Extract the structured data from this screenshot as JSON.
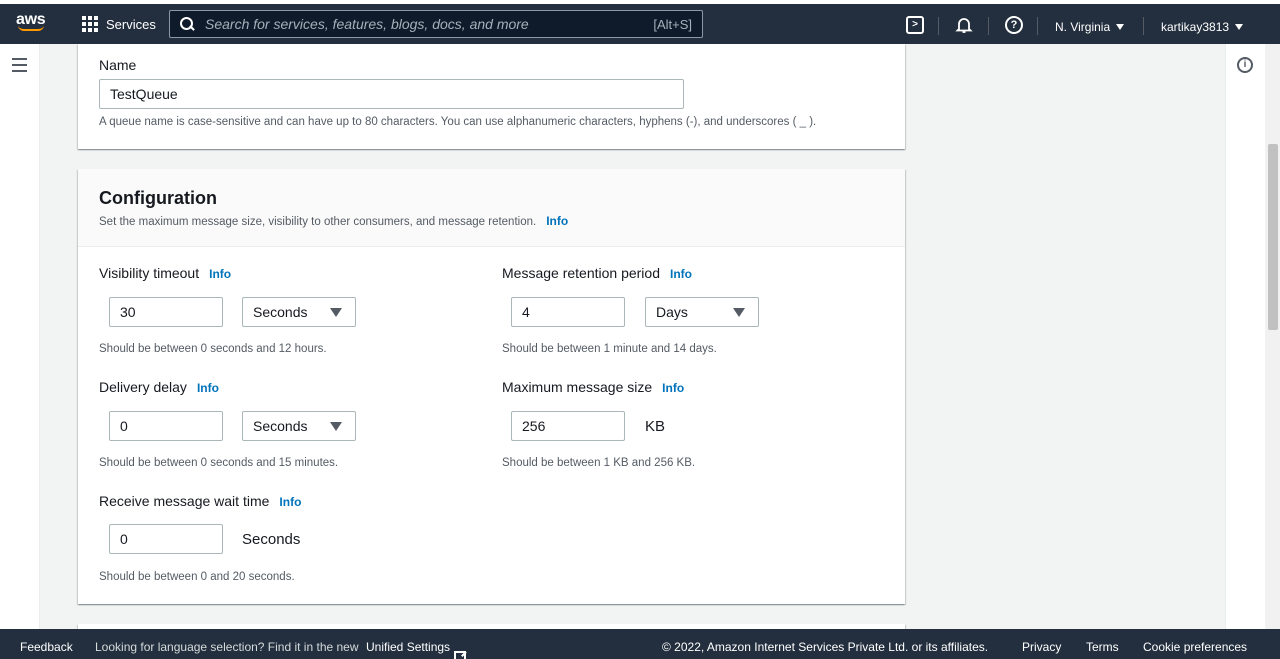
{
  "topnav": {
    "logo": "aws",
    "services_label": "Services",
    "search_placeholder": "Search for services, features, blogs, docs, and more",
    "search_shortcut": "[Alt+S]",
    "region": "N. Virginia",
    "user": "kartikay3813"
  },
  "name_section": {
    "label": "Name",
    "value": "TestQueue",
    "help": "A queue name is case-sensitive and can have up to 80 characters. You can use alphanumeric characters, hyphens (-), and underscores ( _ )."
  },
  "configuration": {
    "title": "Configuration",
    "description": "Set the maximum message size, visibility to other consumers, and message retention.",
    "info": "Info",
    "visibility_timeout": {
      "label": "Visibility timeout",
      "info": "Info",
      "value": "30",
      "unit": "Seconds",
      "help": "Should be between 0 seconds and 12 hours."
    },
    "message_retention": {
      "label": "Message retention period",
      "info": "Info",
      "value": "4",
      "unit": "Days",
      "help": "Should be between 1 minute and 14 days."
    },
    "delivery_delay": {
      "label": "Delivery delay",
      "info": "Info",
      "value": "0",
      "unit": "Seconds",
      "help": "Should be between 0 seconds and 15 minutes."
    },
    "max_message_size": {
      "label": "Maximum message size",
      "info": "Info",
      "value": "256",
      "unit": "KB",
      "help": "Should be between 1 KB and 256 KB."
    },
    "receive_wait_time": {
      "label": "Receive message wait time",
      "info": "Info",
      "value": "0",
      "unit": "Seconds",
      "help": "Should be between 0 and 20 seconds."
    }
  },
  "footer": {
    "feedback": "Feedback",
    "language_text": "Looking for language selection? Find it in the new",
    "unified_settings": "Unified Settings",
    "copyright": "© 2022, Amazon Internet Services Private Ltd. or its affiliates.",
    "privacy": "Privacy",
    "terms": "Terms",
    "cookie": "Cookie preferences"
  },
  "colors": {
    "nav_bg": "#232f3e",
    "accent": "#ff9900",
    "link": "#0073bb"
  }
}
